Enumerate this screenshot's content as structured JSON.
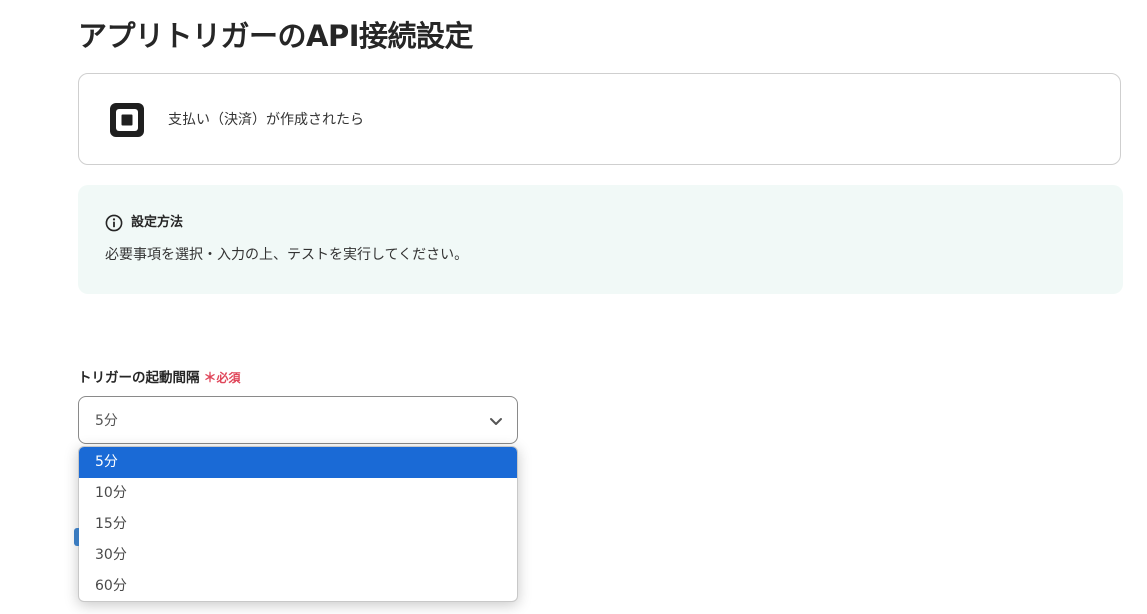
{
  "page": {
    "title": "アプリトリガーのAPI接続設定"
  },
  "trigger": {
    "app_icon": "square-logo-icon",
    "label": "支払い（決済）が作成されたら"
  },
  "info": {
    "icon": "info-circle-icon",
    "title": "設定方法",
    "description": "必要事項を選択・入力の上、テストを実行してください。"
  },
  "interval_field": {
    "label": "トリガーの起動間隔",
    "required_mark": "＊",
    "required_text": "必須",
    "selected_value": "5分",
    "chevron_icon": "chevron-down-icon",
    "options": [
      {
        "label": "5分",
        "selected": true
      },
      {
        "label": "10分",
        "selected": false
      },
      {
        "label": "15分",
        "selected": false
      },
      {
        "label": "30分",
        "selected": false
      },
      {
        "label": "60分",
        "selected": false
      }
    ]
  },
  "colors": {
    "accent": "#1a6ad6",
    "required": "#e0465a",
    "info_background": "#f1f9f7"
  }
}
